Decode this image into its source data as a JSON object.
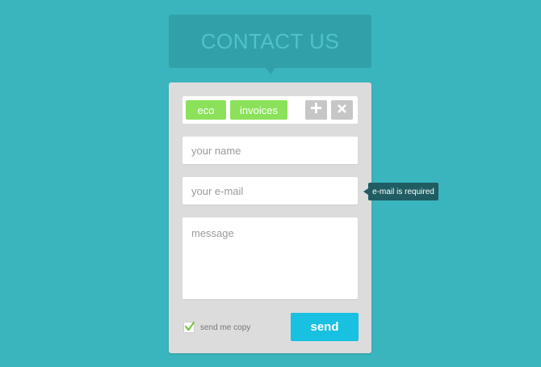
{
  "header": {
    "title": "CONTACT US"
  },
  "tags": {
    "items": [
      {
        "label": "eco"
      },
      {
        "label": "invoices"
      }
    ],
    "add_icon": "plus-icon",
    "clear_icon": "close-icon"
  },
  "form": {
    "name_placeholder": "your name",
    "email_placeholder": "your e-mail",
    "message_placeholder": "message",
    "send_copy_label": "send me copy",
    "send_copy_checked": true,
    "send_label": "send"
  },
  "validation": {
    "email_error": "e-mail is required"
  },
  "colors": {
    "background": "#3bb5bd",
    "header": "#32a0a7",
    "header_text": "#4ec3cc",
    "card": "#dcdcdc",
    "tag": "#8be25a",
    "tag_action": "#c6c6c6",
    "send_button": "#18c0e2",
    "tooltip": "#1f5d63",
    "checkmark": "#7bc142"
  }
}
